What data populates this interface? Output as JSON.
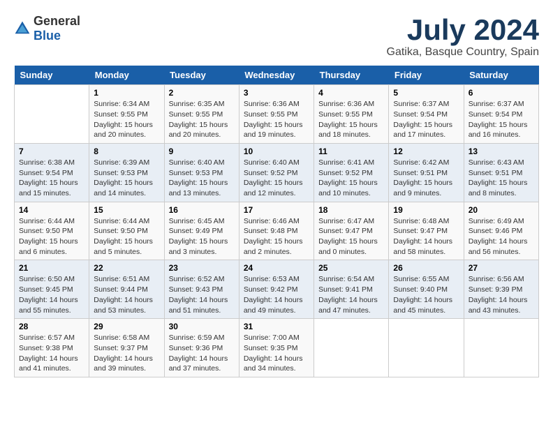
{
  "logo": {
    "general": "General",
    "blue": "Blue"
  },
  "title": {
    "month": "July 2024",
    "location": "Gatika, Basque Country, Spain"
  },
  "headers": [
    "Sunday",
    "Monday",
    "Tuesday",
    "Wednesday",
    "Thursday",
    "Friday",
    "Saturday"
  ],
  "weeks": [
    [
      {
        "day": "",
        "info": ""
      },
      {
        "day": "1",
        "info": "Sunrise: 6:34 AM\nSunset: 9:55 PM\nDaylight: 15 hours\nand 20 minutes."
      },
      {
        "day": "2",
        "info": "Sunrise: 6:35 AM\nSunset: 9:55 PM\nDaylight: 15 hours\nand 20 minutes."
      },
      {
        "day": "3",
        "info": "Sunrise: 6:36 AM\nSunset: 9:55 PM\nDaylight: 15 hours\nand 19 minutes."
      },
      {
        "day": "4",
        "info": "Sunrise: 6:36 AM\nSunset: 9:55 PM\nDaylight: 15 hours\nand 18 minutes."
      },
      {
        "day": "5",
        "info": "Sunrise: 6:37 AM\nSunset: 9:54 PM\nDaylight: 15 hours\nand 17 minutes."
      },
      {
        "day": "6",
        "info": "Sunrise: 6:37 AM\nSunset: 9:54 PM\nDaylight: 15 hours\nand 16 minutes."
      }
    ],
    [
      {
        "day": "7",
        "info": "Sunrise: 6:38 AM\nSunset: 9:54 PM\nDaylight: 15 hours\nand 15 minutes."
      },
      {
        "day": "8",
        "info": "Sunrise: 6:39 AM\nSunset: 9:53 PM\nDaylight: 15 hours\nand 14 minutes."
      },
      {
        "day": "9",
        "info": "Sunrise: 6:40 AM\nSunset: 9:53 PM\nDaylight: 15 hours\nand 13 minutes."
      },
      {
        "day": "10",
        "info": "Sunrise: 6:40 AM\nSunset: 9:52 PM\nDaylight: 15 hours\nand 12 minutes."
      },
      {
        "day": "11",
        "info": "Sunrise: 6:41 AM\nSunset: 9:52 PM\nDaylight: 15 hours\nand 10 minutes."
      },
      {
        "day": "12",
        "info": "Sunrise: 6:42 AM\nSunset: 9:51 PM\nDaylight: 15 hours\nand 9 minutes."
      },
      {
        "day": "13",
        "info": "Sunrise: 6:43 AM\nSunset: 9:51 PM\nDaylight: 15 hours\nand 8 minutes."
      }
    ],
    [
      {
        "day": "14",
        "info": "Sunrise: 6:44 AM\nSunset: 9:50 PM\nDaylight: 15 hours\nand 6 minutes."
      },
      {
        "day": "15",
        "info": "Sunrise: 6:44 AM\nSunset: 9:50 PM\nDaylight: 15 hours\nand 5 minutes."
      },
      {
        "day": "16",
        "info": "Sunrise: 6:45 AM\nSunset: 9:49 PM\nDaylight: 15 hours\nand 3 minutes."
      },
      {
        "day": "17",
        "info": "Sunrise: 6:46 AM\nSunset: 9:48 PM\nDaylight: 15 hours\nand 2 minutes."
      },
      {
        "day": "18",
        "info": "Sunrise: 6:47 AM\nSunset: 9:47 PM\nDaylight: 15 hours\nand 0 minutes."
      },
      {
        "day": "19",
        "info": "Sunrise: 6:48 AM\nSunset: 9:47 PM\nDaylight: 14 hours\nand 58 minutes."
      },
      {
        "day": "20",
        "info": "Sunrise: 6:49 AM\nSunset: 9:46 PM\nDaylight: 14 hours\nand 56 minutes."
      }
    ],
    [
      {
        "day": "21",
        "info": "Sunrise: 6:50 AM\nSunset: 9:45 PM\nDaylight: 14 hours\nand 55 minutes."
      },
      {
        "day": "22",
        "info": "Sunrise: 6:51 AM\nSunset: 9:44 PM\nDaylight: 14 hours\nand 53 minutes."
      },
      {
        "day": "23",
        "info": "Sunrise: 6:52 AM\nSunset: 9:43 PM\nDaylight: 14 hours\nand 51 minutes."
      },
      {
        "day": "24",
        "info": "Sunrise: 6:53 AM\nSunset: 9:42 PM\nDaylight: 14 hours\nand 49 minutes."
      },
      {
        "day": "25",
        "info": "Sunrise: 6:54 AM\nSunset: 9:41 PM\nDaylight: 14 hours\nand 47 minutes."
      },
      {
        "day": "26",
        "info": "Sunrise: 6:55 AM\nSunset: 9:40 PM\nDaylight: 14 hours\nand 45 minutes."
      },
      {
        "day": "27",
        "info": "Sunrise: 6:56 AM\nSunset: 9:39 PM\nDaylight: 14 hours\nand 43 minutes."
      }
    ],
    [
      {
        "day": "28",
        "info": "Sunrise: 6:57 AM\nSunset: 9:38 PM\nDaylight: 14 hours\nand 41 minutes."
      },
      {
        "day": "29",
        "info": "Sunrise: 6:58 AM\nSunset: 9:37 PM\nDaylight: 14 hours\nand 39 minutes."
      },
      {
        "day": "30",
        "info": "Sunrise: 6:59 AM\nSunset: 9:36 PM\nDaylight: 14 hours\nand 37 minutes."
      },
      {
        "day": "31",
        "info": "Sunrise: 7:00 AM\nSunset: 9:35 PM\nDaylight: 14 hours\nand 34 minutes."
      },
      {
        "day": "",
        "info": ""
      },
      {
        "day": "",
        "info": ""
      },
      {
        "day": "",
        "info": ""
      }
    ]
  ]
}
